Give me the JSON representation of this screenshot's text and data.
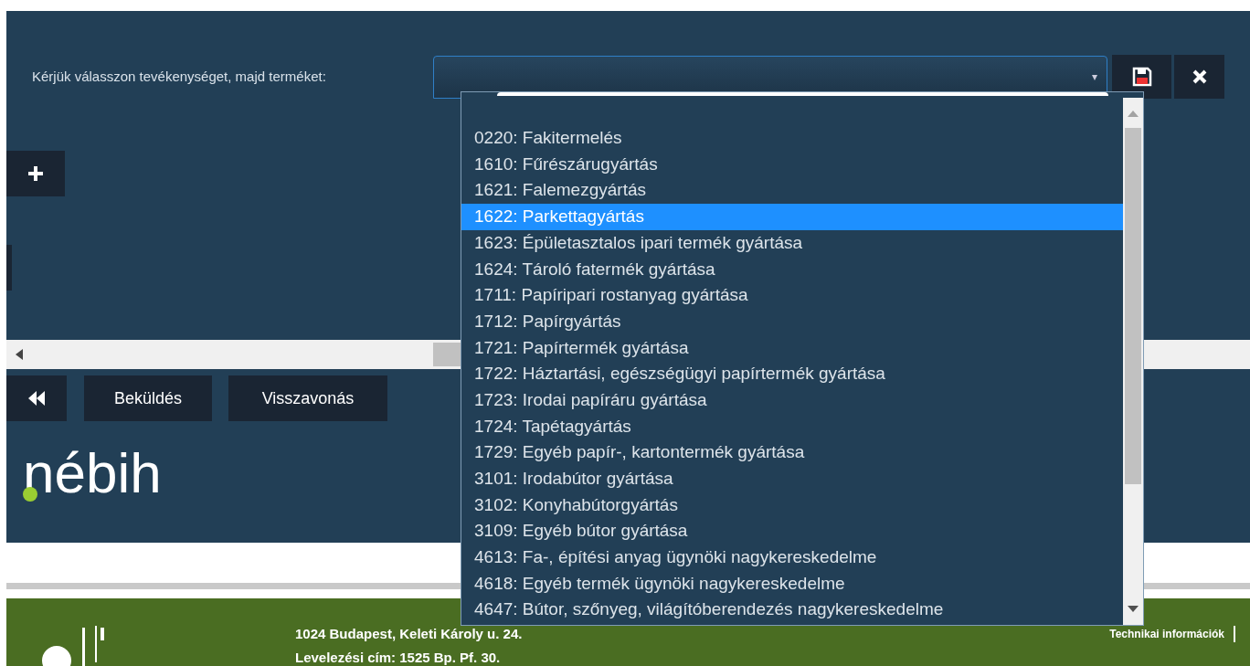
{
  "form": {
    "label": "Kérjük válasszon tevékenységet, majd terméket:",
    "select": {
      "caret": "▾",
      "expanded": true
    }
  },
  "dropdown": {
    "options": [
      {
        "label": "0220: Fakitermelés",
        "selected": false
      },
      {
        "label": "1610: Fűrészárugyártás",
        "selected": false
      },
      {
        "label": "1621: Falemezgyártás",
        "selected": false
      },
      {
        "label": "1622: Parkettagyártás",
        "selected": true
      },
      {
        "label": "1623: Épületasztalos ipari termék gyártása",
        "selected": false
      },
      {
        "label": "1624: Tároló fatermék gyártása",
        "selected": false
      },
      {
        "label": "1711: Papíripari rostanyag gyártása",
        "selected": false
      },
      {
        "label": "1712: Papírgyártás",
        "selected": false
      },
      {
        "label": "1721: Papírtermék gyártása",
        "selected": false
      },
      {
        "label": "1722: Háztartási, egészségügyi papírtermék gyártása",
        "selected": false
      },
      {
        "label": "1723: Irodai papíráru gyártása",
        "selected": false
      },
      {
        "label": "1724: Tapétagyártás",
        "selected": false
      },
      {
        "label": "1729: Egyéb papír-, kartontermék gyártása",
        "selected": false
      },
      {
        "label": "3101: Irodabútor gyártása",
        "selected": false
      },
      {
        "label": "3102: Konyhabútorgyártás",
        "selected": false
      },
      {
        "label": "3109: Egyéb bútor gyártása",
        "selected": false
      },
      {
        "label": "4613: Fa-, építési anyag ügynöki nagykereskedelme",
        "selected": false
      },
      {
        "label": "4618: Egyéb termék ügynöki nagykereskedelme",
        "selected": false
      },
      {
        "label": "4647: Bútor, szőnyeg, világítóberendezés nagykereskedelme",
        "selected": false
      }
    ]
  },
  "actions": {
    "buttons": [
      "Beküldés",
      "Visszavonás"
    ]
  },
  "logo": "nébih",
  "footer": {
    "address": "1024 Budapest, Keleti Károly u. 24.",
    "mail": "Levelezési cím: 1525 Bp. Pf. 30.",
    "link": "Technikai információk"
  }
}
